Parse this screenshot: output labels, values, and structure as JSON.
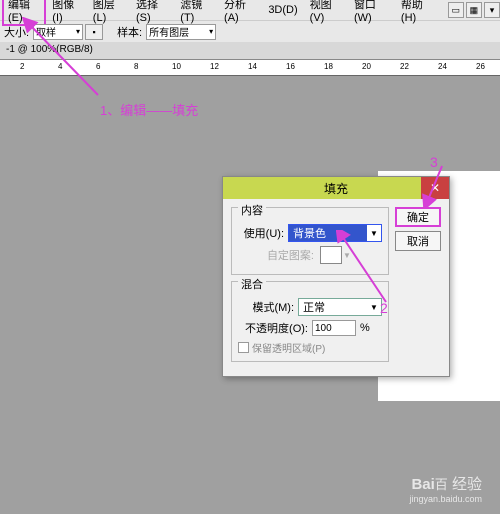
{
  "menubar": {
    "edit": "编辑(E)",
    "image": "图像(I)",
    "layer": "图层(L)",
    "select": "选择(S)",
    "filter": "滤镜(T)",
    "analysis": "分析(A)",
    "3d": "3D(D)",
    "view": "视图(V)",
    "window": "窗口(W)",
    "help": "帮助(H)"
  },
  "toolbar": {
    "size_label": "大小:",
    "size_value": "取样",
    "sample_label": "样本:",
    "sample_value": "所有图层"
  },
  "doc": {
    "tab": "-1 @ 100%(RGB/8)"
  },
  "ruler": {
    "marks": [
      "2",
      "4",
      "6",
      "8",
      "10",
      "12",
      "14",
      "16",
      "18",
      "20",
      "22",
      "24",
      "26"
    ]
  },
  "annotation": {
    "step1": "1、编辑——填充",
    "step2": "2",
    "step3": "3"
  },
  "dialog": {
    "title": "填充",
    "ok": "确定",
    "cancel": "取消",
    "content_group": "内容",
    "use_label": "使用(U):",
    "use_value": "背景色",
    "pattern_label": "自定图案:",
    "blend_group": "混合",
    "mode_label": "模式(M):",
    "mode_value": "正常",
    "opacity_label": "不透明度(O):",
    "opacity_value": "100",
    "percent": "%",
    "preserve_label": "保留透明区域(P)"
  },
  "watermark": {
    "brand": "Bai",
    "brand2": "经验",
    "url": "jingyan.baidu.com"
  },
  "colors": {
    "magenta": "#d63fd6"
  }
}
